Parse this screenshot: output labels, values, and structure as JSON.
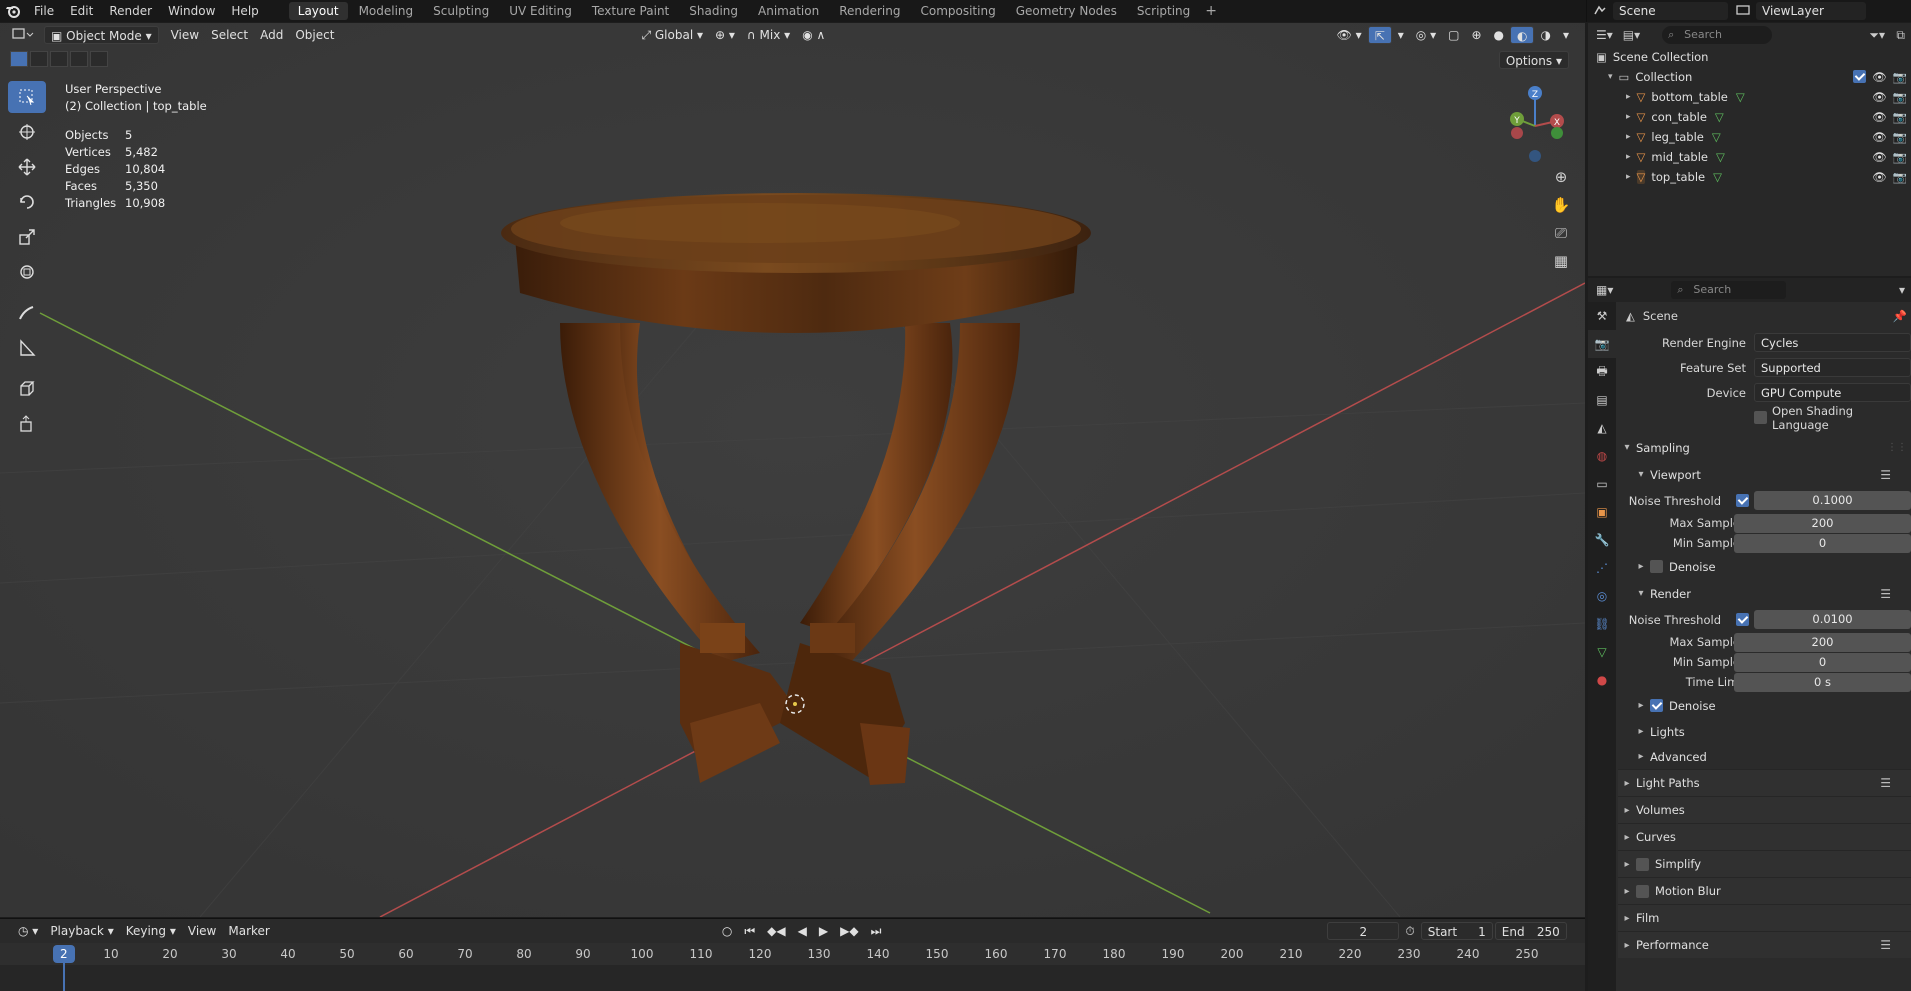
{
  "topbar": {
    "menus": [
      "File",
      "Edit",
      "Render",
      "Window",
      "Help"
    ],
    "workspaces": [
      "Layout",
      "Modeling",
      "Sculpting",
      "UV Editing",
      "Texture Paint",
      "Shading",
      "Animation",
      "Rendering",
      "Compositing",
      "Geometry Nodes",
      "Scripting"
    ],
    "active_workspace": "Layout",
    "add_tab": "+",
    "scene_name": "Scene",
    "view_layer": "ViewLayer"
  },
  "viewport": {
    "mode": "Object Mode",
    "menus": [
      "View",
      "Select",
      "Add",
      "Object"
    ],
    "transform_orientation": "Global",
    "snap_mode": "Mix",
    "options_label": "Options",
    "perspective": "User Perspective",
    "collection_info": "(2) Collection | top_table",
    "stats": [
      {
        "label": "Objects",
        "value": "5"
      },
      {
        "label": "Vertices",
        "value": "5,482"
      },
      {
        "label": "Edges",
        "value": "10,804"
      },
      {
        "label": "Faces",
        "value": "5,350"
      },
      {
        "label": "Triangles",
        "value": "10,908"
      }
    ],
    "gizmo_axes": [
      "X",
      "Y",
      "Z"
    ]
  },
  "timeline": {
    "menus": [
      "Playback",
      "Keying",
      "View",
      "Marker"
    ],
    "current_frame": "2",
    "start_label": "Start",
    "start": "1",
    "end_label": "End",
    "end": "250",
    "ticks": [
      "10",
      "20",
      "30",
      "40",
      "50",
      "60",
      "70",
      "80",
      "90",
      "100",
      "110",
      "120",
      "130",
      "140",
      "150",
      "160",
      "170",
      "180",
      "190",
      "200",
      "210",
      "220",
      "230",
      "240",
      "250"
    ]
  },
  "outliner": {
    "search_placeholder": "Search",
    "root": "Scene Collection",
    "collection": "Collection",
    "objects": [
      "bottom_table",
      "con_table",
      "leg_table",
      "mid_table",
      "top_table"
    ]
  },
  "properties": {
    "search_placeholder": "Search",
    "context": "Scene",
    "render_engine_label": "Render Engine",
    "render_engine": "Cycles",
    "feature_set_label": "Feature Set",
    "feature_set": "Supported",
    "device_label": "Device",
    "device": "GPU Compute",
    "osl_label": "Open Shading Language",
    "sampling": "Sampling",
    "viewport_section": "Viewport",
    "noise_threshold_label": "Noise Threshold",
    "vp_noise_threshold": "0.1000",
    "max_samples_label": "Max Samples",
    "vp_max_samples": "200",
    "min_samples_label": "Min Samples",
    "vp_min_samples": "0",
    "denoise_label": "Denoise",
    "render_section": "Render",
    "r_noise_threshold": "0.0100",
    "r_max_samples": "200",
    "r_min_samples": "0",
    "time_limit_label": "Time Limit",
    "r_time_limit": "0 s",
    "lights": "Lights",
    "advanced": "Advanced",
    "panels": [
      "Light Paths",
      "Volumes",
      "Curves",
      "Simplify",
      "Motion Blur",
      "Film",
      "Performance"
    ]
  },
  "colors": {
    "accent": "#4772b3",
    "viewport_bg": "#393939",
    "x_axis": "#b34c4c",
    "y_axis": "#6f9e3a",
    "z_axis": "#4a7fc9"
  }
}
